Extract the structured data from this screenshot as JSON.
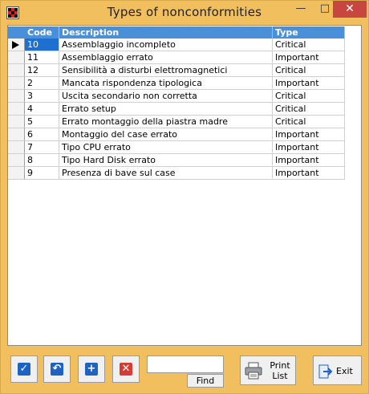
{
  "window": {
    "title": "Types of nonconformities",
    "minimize": "—",
    "maximize": "□",
    "close": "✕"
  },
  "grid": {
    "headers": {
      "code": "Code",
      "description": "Description",
      "type": "Type"
    },
    "rows": [
      {
        "code": "10",
        "description": "Assemblaggio incompleto",
        "type": "Critical"
      },
      {
        "code": "11",
        "description": "Assemblaggio errato",
        "type": "Important"
      },
      {
        "code": "12",
        "description": "Sensibilità a disturbi elettromagnetici",
        "type": "Critical"
      },
      {
        "code": "2",
        "description": "Mancata rispondenza tipologica",
        "type": "Important"
      },
      {
        "code": "3",
        "description": "Uscita secondario non corretta",
        "type": "Critical"
      },
      {
        "code": "4",
        "description": "Errato setup",
        "type": "Critical"
      },
      {
        "code": "5",
        "description": "Errato montaggio della piastra madre",
        "type": "Critical"
      },
      {
        "code": "6",
        "description": "Montaggio del case errato",
        "type": "Important"
      },
      {
        "code": "7",
        "description": "Tipo CPU errato",
        "type": "Important"
      },
      {
        "code": "8",
        "description": "Tipo Hard Disk errato",
        "type": "Important"
      },
      {
        "code": "9",
        "description": "Presenza di bave sul case",
        "type": "Important"
      }
    ]
  },
  "toolbar": {
    "search_value": "",
    "find_label": "Find",
    "print_line1": "Print",
    "print_line2": "List",
    "exit_label": "Exit"
  },
  "colors": {
    "accent": "#4a90d9",
    "confirm": "#1e63c4",
    "delete": "#d43d36"
  }
}
